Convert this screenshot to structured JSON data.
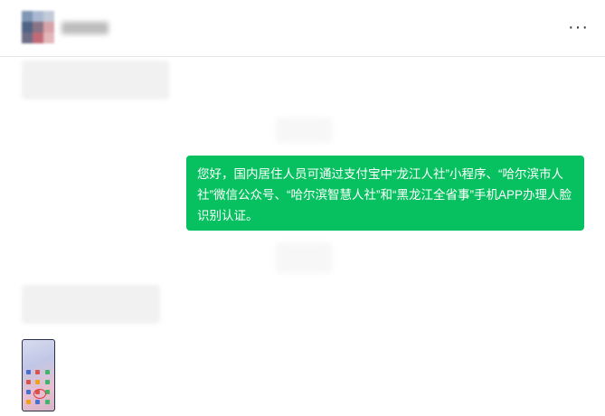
{
  "header": {
    "more_icon": "more-icon"
  },
  "messages": [
    {
      "direction": "sent",
      "text": "您好，国内居住人员可通过支付宝中“龙江人社”小程序、“哈尔滨市人社”微信公众号、“哈尔滨智慧人社”和“黑龙江全省事”手机APP办理人脸识别认证。"
    }
  ],
  "colors": {
    "sent_bubble": "#07c160",
    "divider": "#e6e6e6"
  }
}
